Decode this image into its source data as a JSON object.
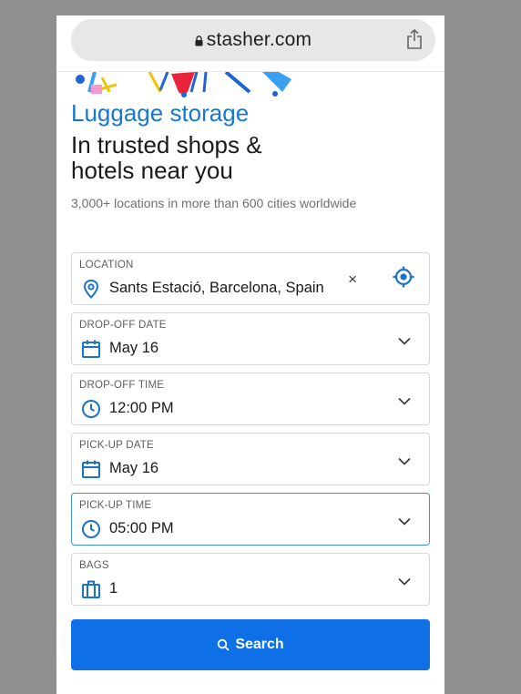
{
  "browser": {
    "url": "stasher.com",
    "lock_icon": "lock-icon",
    "share_icon": "share-icon"
  },
  "hero": {
    "brand_title": "Luggage storage",
    "headline_line1": "In trusted shops &",
    "headline_line2": "hotels near you",
    "subline": "3,000+ locations in more than 600 cities worldwide"
  },
  "form": {
    "location": {
      "label": "LOCATION",
      "value": "Sants Estació, Barcelona, Spain",
      "clear_glyph": "×",
      "icon": "map-pin-icon",
      "locate_icon": "crosshair-icon"
    },
    "dropoff_date": {
      "label": "DROP-OFF DATE",
      "value": "May 16",
      "icon": "calendar-icon"
    },
    "dropoff_time": {
      "label": "DROP-OFF TIME",
      "value": "12:00 PM",
      "icon": "clock-icon"
    },
    "pickup_date": {
      "label": "PICK-UP DATE",
      "value": "May 16",
      "icon": "calendar-icon"
    },
    "pickup_time": {
      "label": "PICK-UP TIME",
      "value": "05:00 PM",
      "icon": "clock-icon"
    },
    "bags": {
      "label": "BAGS",
      "value": "1",
      "icon": "briefcase-icon"
    },
    "search_label": "Search"
  },
  "colors": {
    "brand_blue": "#1677d4",
    "button_blue": "#0f6fe6",
    "icon_blue": "#1a73c9",
    "active_border": "#3b8fe6"
  }
}
